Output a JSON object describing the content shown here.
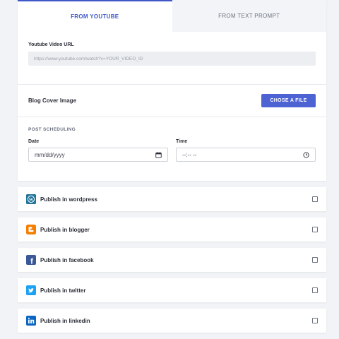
{
  "tabs": [
    {
      "label": "FROM YOUTUBE",
      "active": true
    },
    {
      "label": "FROM TEXT PROMPT",
      "active": false
    }
  ],
  "youtube": {
    "label": "Youtube Video URL",
    "placeholder": "https://www.youtube.com/watch?v=YOUR_VIDEO_ID"
  },
  "cover": {
    "label": "Blog Cover Image",
    "button_label": "CHOSE A FILE"
  },
  "scheduling": {
    "heading": "POST SCHEDULING",
    "date_label": "Date",
    "date_value": "mm/dd/yyyy",
    "time_label": "Time",
    "time_value": "--:-- --"
  },
  "publish": [
    {
      "label": "Publish in wordpress",
      "icon": "wordpress-icon",
      "color": "#21759b"
    },
    {
      "label": "Publish in blogger",
      "icon": "blogger-icon",
      "color": "#f57d00"
    },
    {
      "label": "Publish in facebook",
      "icon": "facebook-icon",
      "color": "#3b5998"
    },
    {
      "label": "Publish in twitter",
      "icon": "twitter-icon",
      "color": "#1da1f2"
    },
    {
      "label": "Publish in linkedin",
      "icon": "linkedin-icon",
      "color": "#0a66c2"
    }
  ],
  "colors": {
    "accent": "#4d63d4",
    "tab_active": "#3f57c9"
  }
}
